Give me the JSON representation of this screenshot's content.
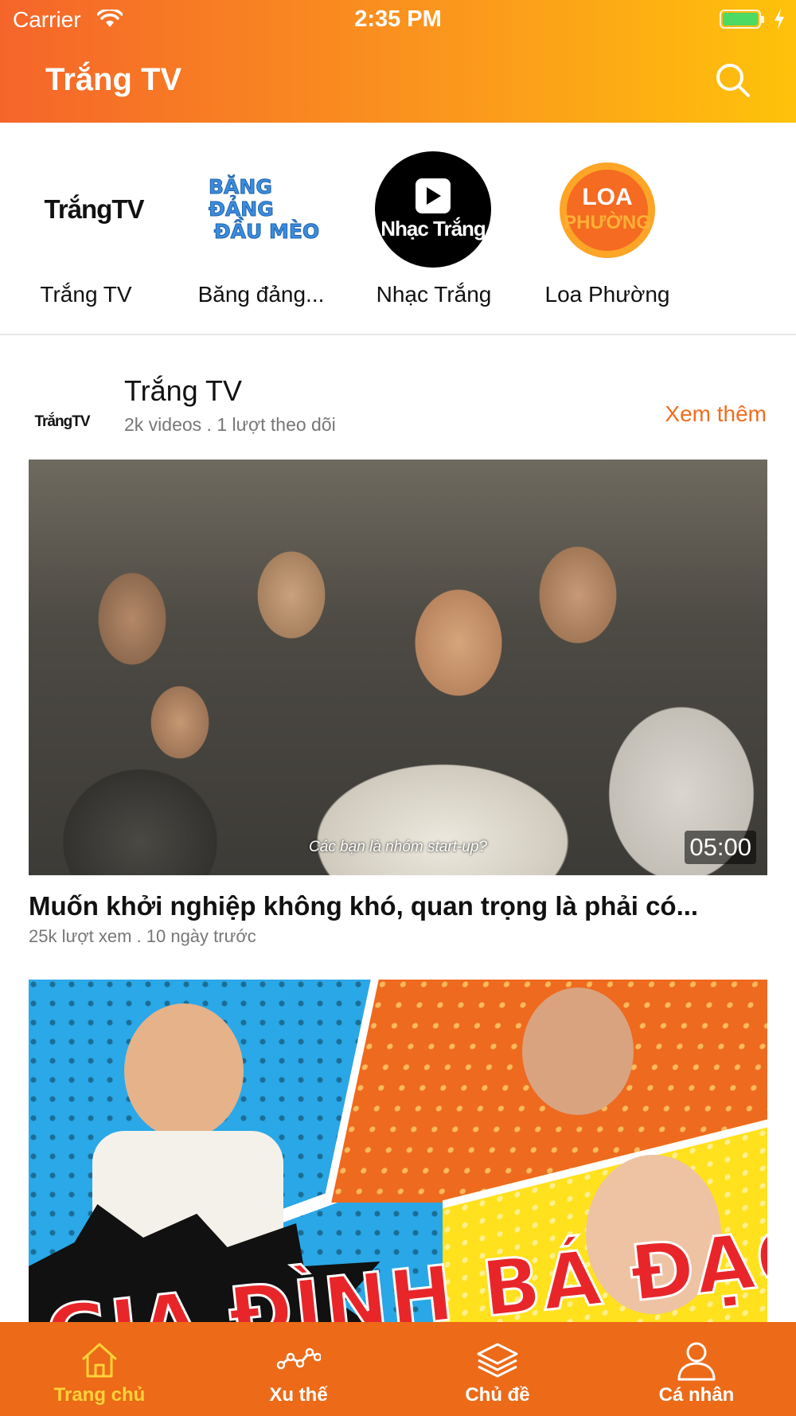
{
  "status_bar": {
    "carrier": "Carrier",
    "time": "2:35 PM"
  },
  "header": {
    "title": "Trắng TV",
    "search_icon": "search-icon"
  },
  "channels": [
    {
      "name": "Trắng TV",
      "logo_text": "TrắngTV"
    },
    {
      "name": "Băng đảng...",
      "logo_line1": "BĂNG ĐẢNG",
      "logo_line2": "ĐẦU MÈO"
    },
    {
      "name": "Nhạc Trắng",
      "logo_text": "Nhạc Trắng"
    },
    {
      "name": "Loa Phường",
      "logo_line1": "LOA",
      "logo_line2": "PHƯỜNG"
    }
  ],
  "section": {
    "avatar_text": "TrắngTV",
    "title": "Trắng TV",
    "meta": "2k videos . 1 lượt theo dõi",
    "see_more": "Xem thêm"
  },
  "videos": [
    {
      "subtitle": "Các bạn là nhóm start-up?",
      "duration": "05:00",
      "title": "Muốn khởi nghiệp không khó, quan trọng là phải có...",
      "meta": "25k lượt xem . 10 ngày trước"
    },
    {
      "thumb_text": "GIA ĐÌNH BÁ ĐẠO"
    }
  ],
  "tabbar": {
    "items": [
      {
        "label": "Trang chủ",
        "icon": "home-icon",
        "active": true
      },
      {
        "label": "Xu thế",
        "icon": "trend-icon",
        "active": false
      },
      {
        "label": "Chủ đề",
        "icon": "layers-icon",
        "active": false
      },
      {
        "label": "Cá nhân",
        "icon": "user-icon",
        "active": false
      }
    ]
  },
  "colors": {
    "accent": "#f26d1f",
    "tabbar": "#ec6a18",
    "active_tab": "#ffd23a"
  }
}
